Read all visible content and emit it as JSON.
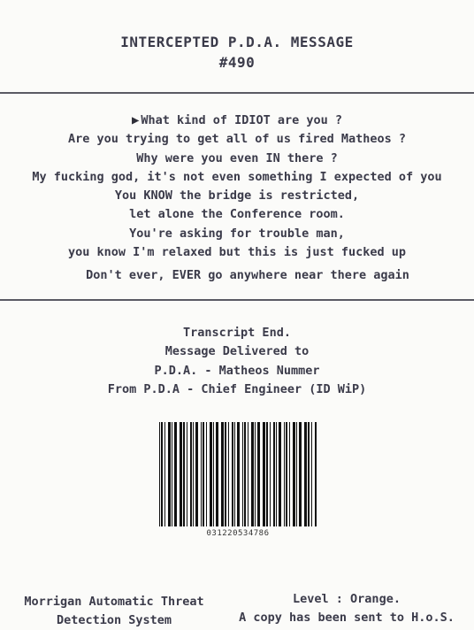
{
  "header": {
    "title": "INTERCEPTED P.D.A. MESSAGE",
    "number": "#490"
  },
  "message": {
    "lines": [
      "What kind of IDIOT are you ?",
      "Are you trying to get all of us fired Matheos ?",
      "Why were you even IN there ?",
      "My fucking god, it's not even something I expected of you",
      "You KNOW the bridge is restricted,",
      "let alone the Conference room.",
      "You're asking for trouble man,",
      "you know I'm relaxed but this is just fucked up",
      "Don't ever, EVER go anywhere near there again"
    ]
  },
  "transcript": {
    "end": "Transcript End.",
    "delivered": "Message Delivered to",
    "recipient": "P.D.A. - Matheos Nummer",
    "sender": "From P.D.A - Chief Engineer (ID WiP)"
  },
  "barcode": {
    "number": "031220534786"
  },
  "footer": {
    "system_line1": "Morrigan Automatic Threat",
    "system_line2": "Detection System",
    "level": "Level : Orange.",
    "copy": "A copy has been sent to H.o.S."
  },
  "colors": {
    "text": "#3b3b4a",
    "background": "#fbfbf9"
  },
  "icons": {
    "message_marker": "right-triangle-icon"
  }
}
